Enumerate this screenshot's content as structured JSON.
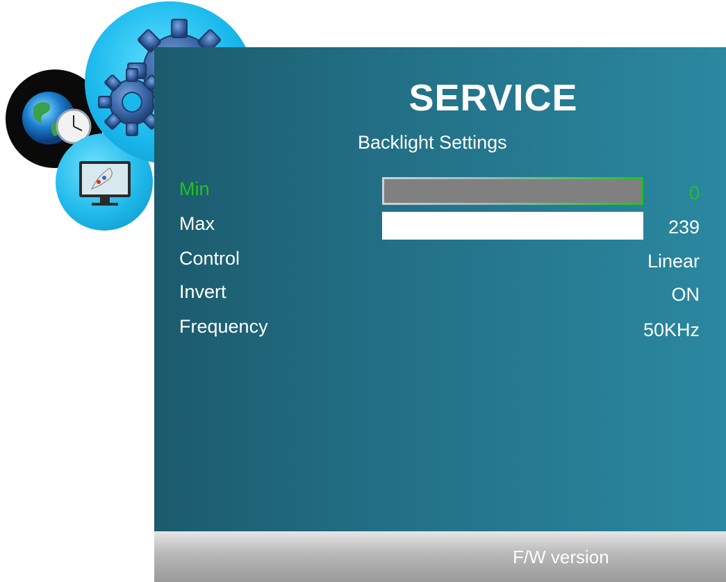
{
  "header": {
    "title": "SERVICE",
    "subtitle": "Backlight Settings"
  },
  "settings": {
    "min": {
      "label": "Min",
      "value": "0",
      "level": 0,
      "selected": true
    },
    "max": {
      "label": "Max",
      "value": "239",
      "level": 1
    },
    "control": {
      "label": "Control",
      "value": "Linear"
    },
    "invert": {
      "label": "Invert",
      "value": "ON"
    },
    "frequency": {
      "label": "Frequency",
      "value": "50KHz"
    }
  },
  "footer": {
    "fw_label": "F/W version"
  },
  "icons": [
    "gears-icon",
    "globe-clock-icon",
    "monitor-icon"
  ],
  "colors": {
    "selected_text": "#22c21c",
    "panel": "#226f85",
    "slider_track": "#808080",
    "slider_fill": "#ffffff"
  }
}
